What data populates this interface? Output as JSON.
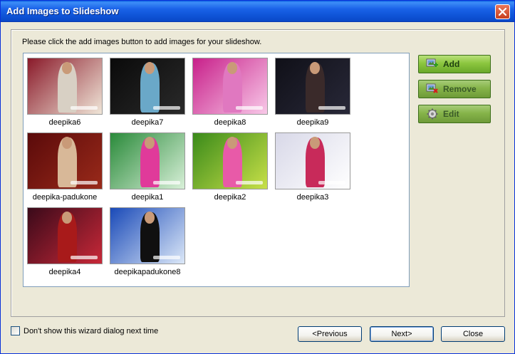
{
  "window": {
    "title": "Add Images to Slideshow"
  },
  "instruction": "Please click the add images button to add  images for your slideshow.",
  "images": [
    {
      "caption": "deepika6",
      "bg": [
        "#8a1a2a",
        "#f0e6d8"
      ],
      "cloth": "#d8d0c4"
    },
    {
      "caption": "deepika7",
      "bg": [
        "#0a0a0a",
        "#2a2a2a"
      ],
      "cloth": "#6aa8c8"
    },
    {
      "caption": "deepika8",
      "bg": [
        "#c8208a",
        "#f8c8e8"
      ],
      "cloth": "#e078c0"
    },
    {
      "caption": "deepika9",
      "bg": [
        "#101018",
        "#282838"
      ],
      "cloth": "#3a2a2a"
    },
    {
      "caption": "deepika-padukone",
      "bg": [
        "#5a0a0a",
        "#9a2a1a"
      ],
      "cloth": "#d8b898"
    },
    {
      "caption": "deepika1",
      "bg": [
        "#2a8a3a",
        "#d8f0d8"
      ],
      "cloth": "#e03a9a"
    },
    {
      "caption": "deepika2",
      "bg": [
        "#3a8a1a",
        "#c8e048"
      ],
      "cloth": "#e85aa8"
    },
    {
      "caption": "deepika3",
      "bg": [
        "#d8d8e8",
        "#ffffff"
      ],
      "cloth": "#c82a5a"
    },
    {
      "caption": "deepika4",
      "bg": [
        "#3a0a1a",
        "#c82838"
      ],
      "cloth": "#a81a1a"
    },
    {
      "caption": "deepikapadukone8",
      "bg": [
        "#1a4ab8",
        "#dce8f8"
      ],
      "cloth": "#101010"
    }
  ],
  "buttons": {
    "add": "Add",
    "remove": "Remove",
    "edit": "Edit"
  },
  "footer": {
    "checkbox_label": "Don't show this wizard dialog next time",
    "previous": "<Previous",
    "next": "Next>",
    "close": "Close"
  },
  "icons": {
    "close": "close-icon",
    "add": "add-image-icon",
    "remove": "remove-image-icon",
    "edit": "gear-icon"
  }
}
